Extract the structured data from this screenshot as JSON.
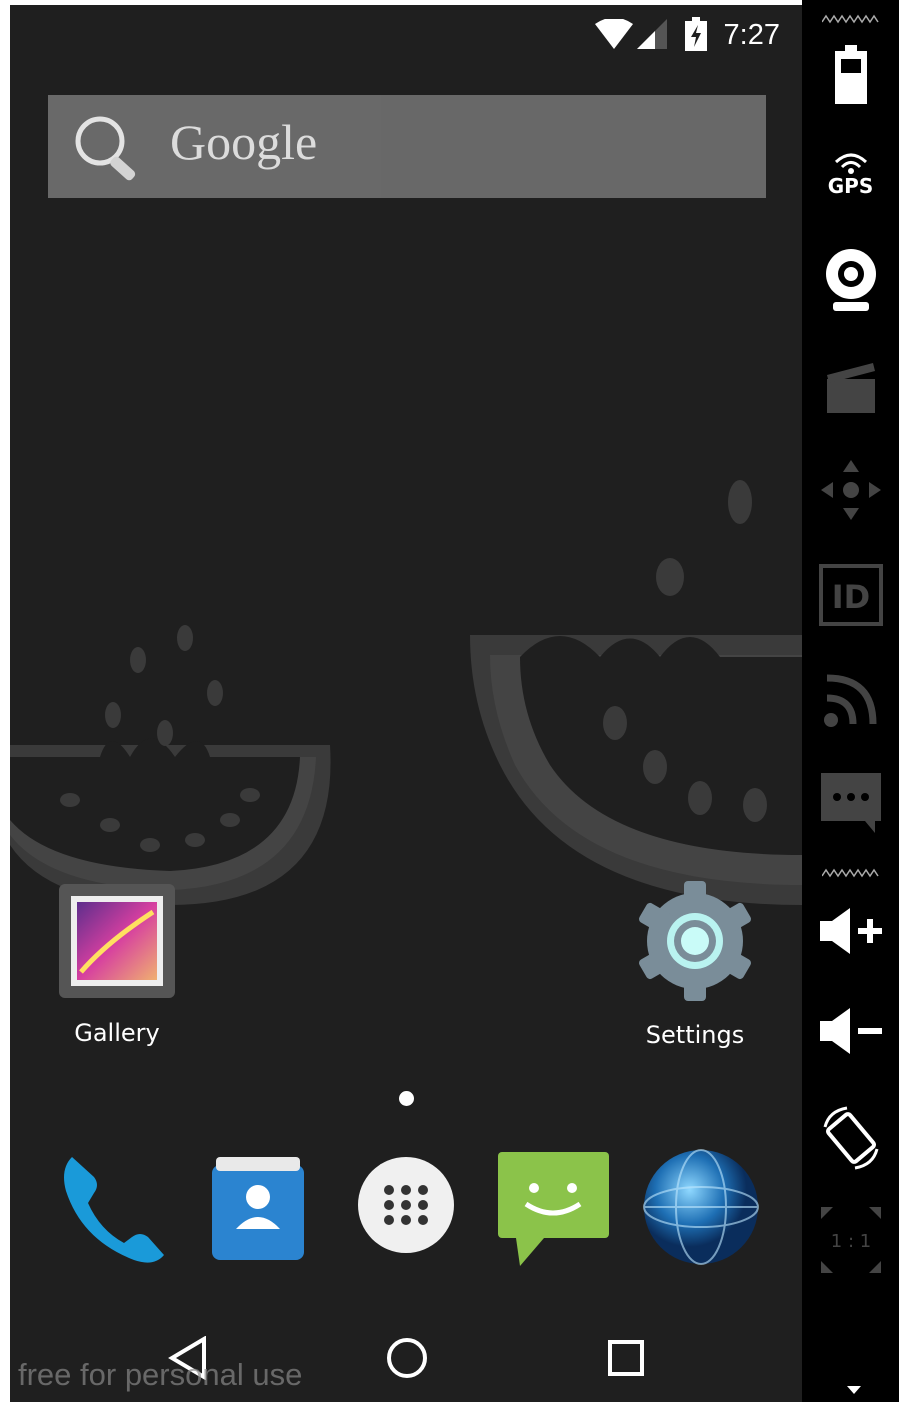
{
  "status_bar": {
    "time": "7:27"
  },
  "search": {
    "label": "Google"
  },
  "apps": [
    {
      "label": "Gallery"
    },
    {
      "label": "Settings"
    }
  ],
  "dock": {
    "items": [
      "phone-icon",
      "contacts-icon",
      "app-drawer-icon",
      "messaging-icon",
      "browser-icon"
    ]
  },
  "nav": {
    "items": [
      "back-icon",
      "home-icon",
      "recents-icon"
    ]
  },
  "watermark": "free for personal use",
  "side_panel": {
    "gps_label": "GPS",
    "id_label": "ID",
    "ratio_label": "1 : 1"
  }
}
